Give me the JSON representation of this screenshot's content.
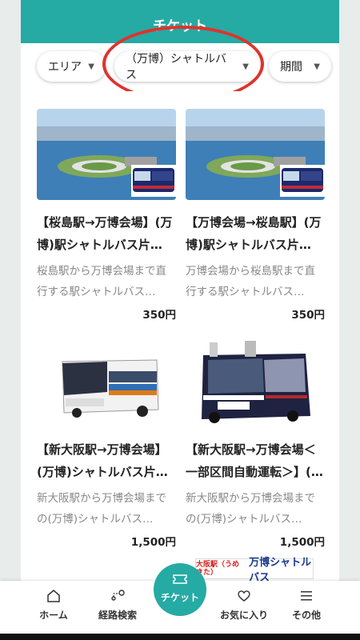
{
  "header": {
    "title": "チケット"
  },
  "filters": [
    {
      "label": "エリア"
    },
    {
      "label": "（万博）シャトルバス"
    },
    {
      "label": "期間"
    }
  ],
  "cards": [
    {
      "title": "【桜島駅→万博会場】(万博)駅シャトルバス片…",
      "desc": "桜島駅から万博会場まで直行する駅シャトルバス…",
      "price": "350円",
      "image": "expo-site-aerial-with-bus"
    },
    {
      "title": "【万博会場→桜島駅】(万博)駅シャトルバス片…",
      "desc": "万博会場から桜島駅まで直行する駅シャトルバス…",
      "price": "350円",
      "image": "expo-site-aerial-with-bus"
    },
    {
      "title": "【新大阪駅→万博会場】(万博)シャトルバス片…",
      "desc": "新大阪駅から万博会場までの(万博)シャトルバス…",
      "price": "1,500円",
      "image": "highway-coach-bus"
    },
    {
      "title": "【新大阪駅→万博会場＜一部区間自動運転＞】(…",
      "desc": "新大阪駅から万博会場までの(万博)シャトルバス…",
      "price": "1,500円",
      "image": "autonomous-electric-bus"
    }
  ],
  "banner": {
    "left": "大阪駅（うめきた）",
    "main": "万博シャトルバス"
  },
  "nav": {
    "home": "ホーム",
    "route": "経路検索",
    "ticket": "チケット",
    "favorites": "お気に入り",
    "other": "その他"
  },
  "colors": {
    "accent": "#26aaa4",
    "highlight": "#e0322c"
  }
}
